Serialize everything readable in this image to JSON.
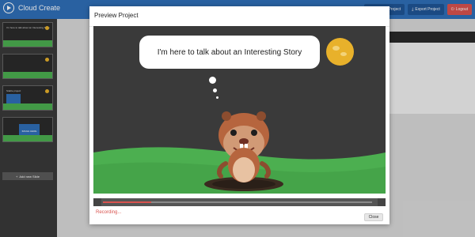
{
  "app": {
    "name": "Cloud Create",
    "header_actions": [
      {
        "label": "Preview Project",
        "icon": "eye-icon"
      },
      {
        "label": "Export Project",
        "icon": "download-icon"
      },
      {
        "label": "Logout",
        "icon": "power-icon"
      }
    ]
  },
  "sidebar": {
    "slides": [
      {
        "text": "I'm here to talk about an Interesting Story"
      },
      {
        "text": ""
      },
      {
        "text": "Stable project"
      },
      {
        "text": "IMAGE HERE"
      }
    ],
    "add_slide_label": "Add new Slide"
  },
  "modal": {
    "title": "Preview Project",
    "speech_text": "I'm here to talk about an Interesting Story",
    "recording_text": "Recording...",
    "close_label": "Close",
    "progress_fraction": 0.18
  },
  "colors": {
    "topbar": "#2f6fb8",
    "accent_red": "#d9534f",
    "stage_bg": "#3a3a3a",
    "grass": "#4caf50",
    "moon": "#e8b12b"
  }
}
